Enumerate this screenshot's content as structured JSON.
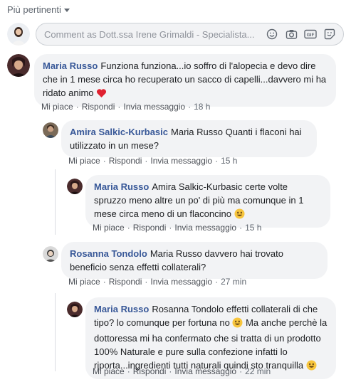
{
  "sort": {
    "label": "Più pertinenti"
  },
  "composer": {
    "placeholder": "Comment as Dott.ssa Irene Grimaldi - Specialista..."
  },
  "comments": [
    {
      "author": "Maria Russo",
      "text": "Funziona funziona...io soffro di l'alopecia e devo dire che in 1 mese circa ho recuperato un sacco di capelli...davvero mi ha ridato animo",
      "emoji": "heart",
      "like": "Mi piace",
      "reply": "Rispondi",
      "message": "Invia messaggio",
      "time": "18 h"
    },
    {
      "author": "Amira Salkic-Kurbasic",
      "text": "Maria Russo Quanti i flaconi hai utilizzato in un mese?",
      "like": "Mi piace",
      "reply": "Rispondi",
      "message": "Invia messaggio",
      "time": "15 h"
    },
    {
      "author": "Maria Russo",
      "text": "Amira Salkic-Kurbasic certe volte spruzzo meno altre un po' di più ma comunque in 1 mese circa meno di un flaconcino",
      "emoji": "smile",
      "like": "Mi piace",
      "reply": "Rispondi",
      "message": "Invia messaggio",
      "time": "15 h"
    },
    {
      "author": "Rosanna Tondolo",
      "text": "Maria Russo davvero hai trovato beneficio senza effetti collaterali?",
      "like": "Mi piace",
      "reply": "Rispondi",
      "message": "Invia messaggio",
      "time": "27 min"
    },
    {
      "author": "Maria Russo",
      "text_part1": "Rosanna Tondolo effetti collaterali di che tipo? lo comunque per fortuna no",
      "text_part2": "Ma anche perchè la dottoressa mi ha confermato che si tratta di un prodotto 100% Naturale e pure sulla confezione infatti lo riporta...ingredienti tutti naturali quindi sto tranquilla",
      "emoji": "smile",
      "like": "Mi piace",
      "reply": "Rispondi",
      "message": "Invia messaggio",
      "time": "22 min"
    }
  ]
}
